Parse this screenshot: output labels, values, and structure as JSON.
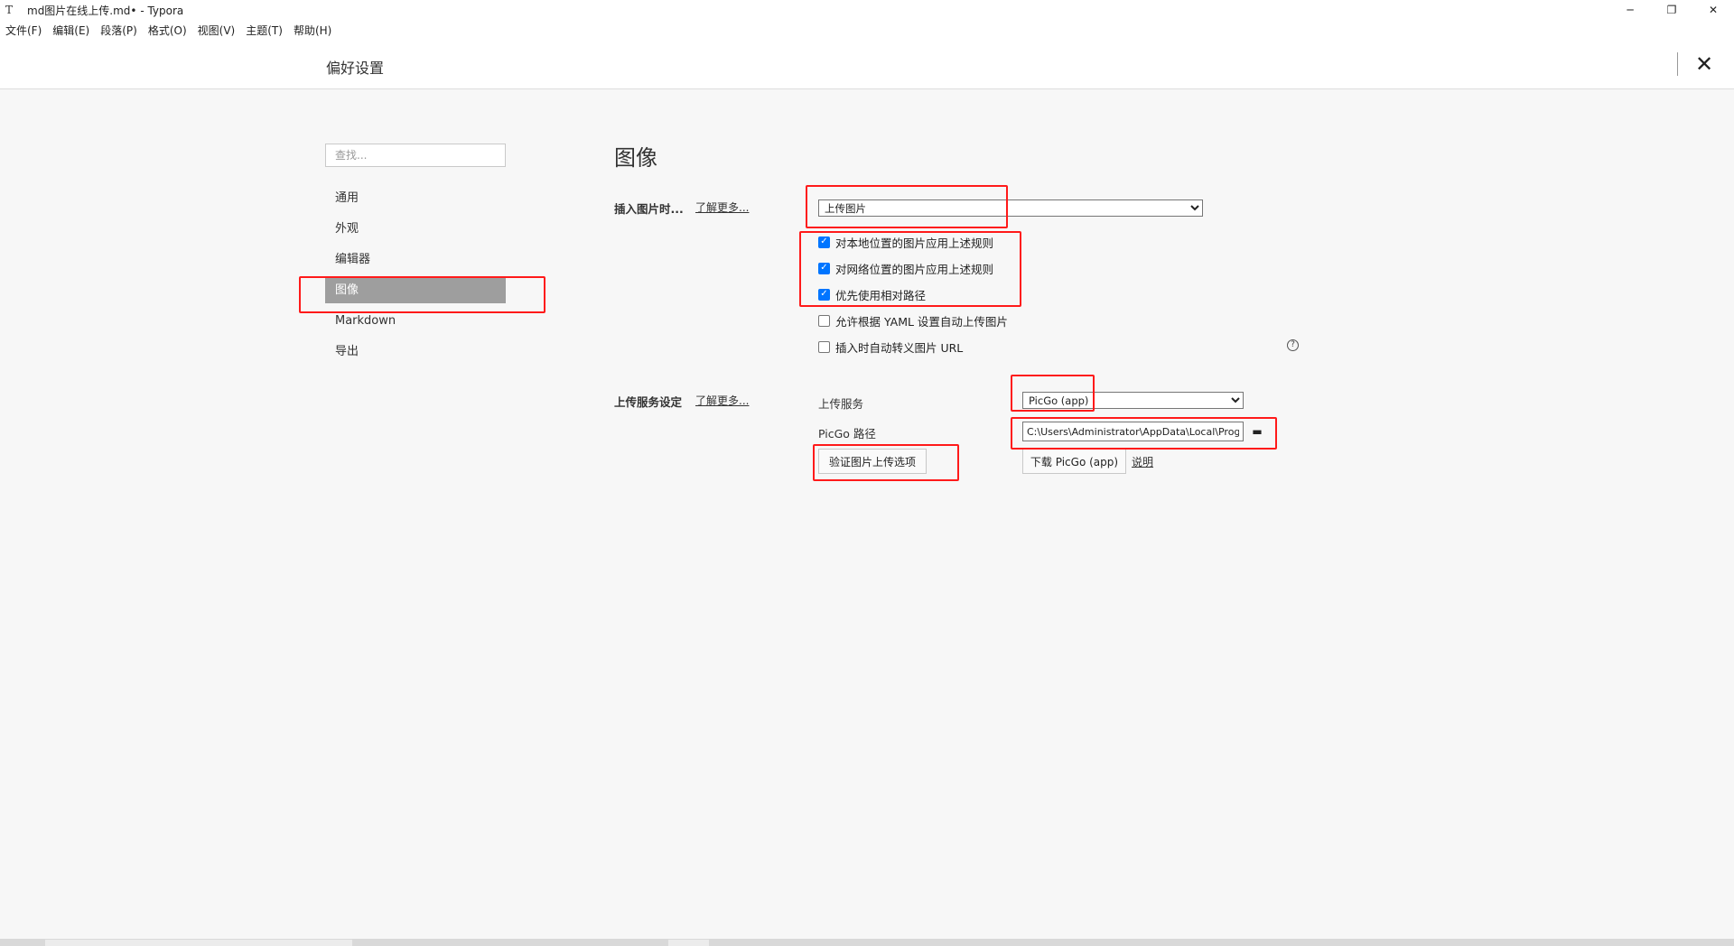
{
  "window": {
    "app_icon": "T",
    "title": "md图片在线上传.md• - Typora",
    "controls": {
      "minimize": "─",
      "restore": "❐",
      "close": "✕"
    }
  },
  "menu": [
    "文件(F)",
    "编辑(E)",
    "段落(P)",
    "格式(O)",
    "视图(V)",
    "主题(T)",
    "帮助(H)"
  ],
  "preferences": {
    "title": "偏好设置",
    "close_icon": "✕"
  },
  "sidebar": {
    "search_placeholder": "查找...",
    "items": [
      {
        "label": "通用",
        "active": false
      },
      {
        "label": "外观",
        "active": false
      },
      {
        "label": "编辑器",
        "active": false
      },
      {
        "label": "图像",
        "active": true
      },
      {
        "label": "Markdown",
        "active": false
      },
      {
        "label": "导出",
        "active": false
      }
    ]
  },
  "image_section": {
    "title": "图像",
    "insert_label": "插入图片时...",
    "learn_more": "了解更多...",
    "insert_action": "上传图片",
    "options": [
      {
        "label": "对本地位置的图片应用上述规则",
        "checked": true
      },
      {
        "label": "对网络位置的图片应用上述规则",
        "checked": true
      },
      {
        "label": "优先使用相对路径",
        "checked": true
      },
      {
        "label": "允许根据 YAML 设置自动上传图片",
        "checked": false
      },
      {
        "label": "插入时自动转义图片 URL",
        "checked": false
      }
    ],
    "help_icon": "?"
  },
  "upload_section": {
    "label": "上传服务设定",
    "learn_more": "了解更多...",
    "service_label": "上传服务",
    "service_value": "PicGo (app)",
    "path_label": "PicGo 路径",
    "path_value": "C:\\Users\\Administrator\\AppData\\Local\\Programs\\PicGo\\PicGo.exe",
    "folder_icon": "▬",
    "verify_button": "验证图片上传选项",
    "download_button": "下载 PicGo (app)",
    "explain_link": "说明"
  },
  "colors": {
    "annotation": "#ff1a1a",
    "active_nav": "#9e9e9e",
    "checkbox": "#0075ff"
  }
}
